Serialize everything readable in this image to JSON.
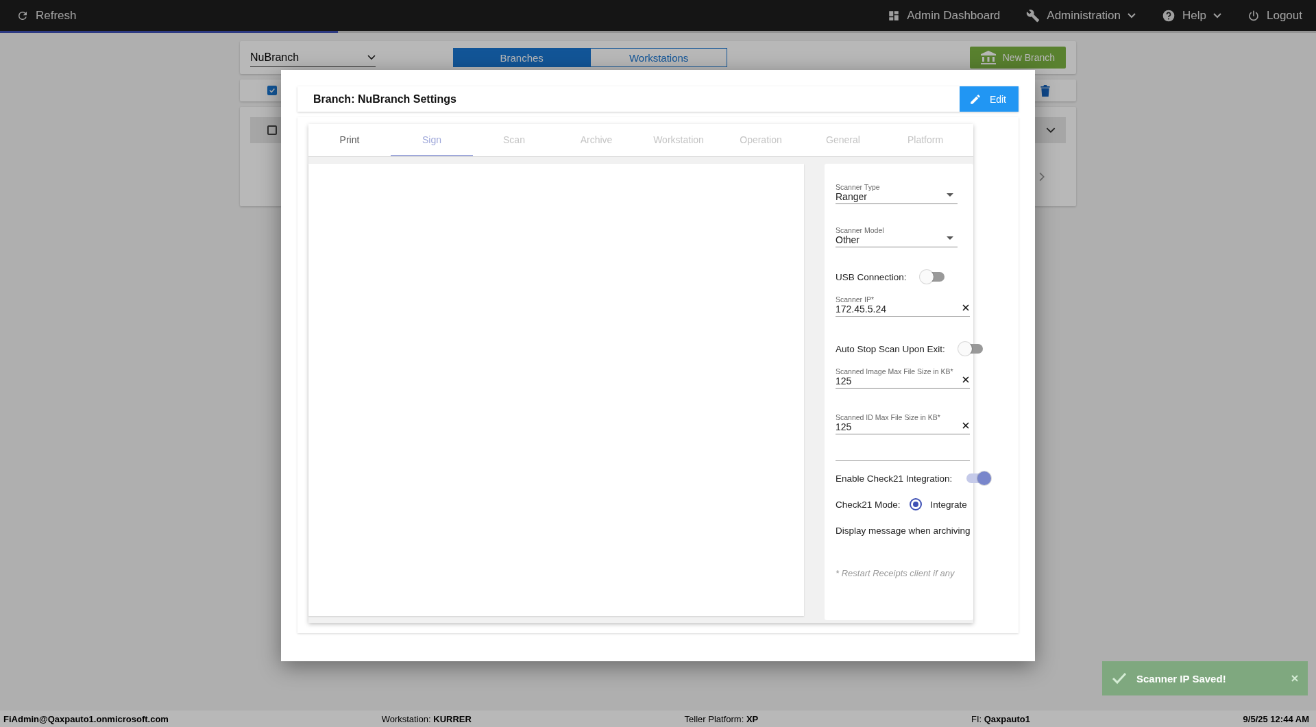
{
  "top_bar": {
    "refresh": "Refresh",
    "nav": [
      {
        "kind": "dashboard",
        "label": "Admin Dashboard",
        "dropdown": false
      },
      {
        "kind": "wrench",
        "label": "Administration",
        "dropdown": true
      },
      {
        "kind": "help",
        "label": "Help",
        "dropdown": true
      },
      {
        "kind": "power",
        "label": "Logout",
        "dropdown": false
      }
    ]
  },
  "progress": {
    "level": 0.257
  },
  "page": {
    "branch_select": "NuBranch",
    "toggle": [
      {
        "label": "Branches",
        "selected": true
      },
      {
        "label": "Workstations",
        "selected": false
      }
    ],
    "new_button": "New Branch",
    "select_all_checked": true,
    "row_checked": false
  },
  "dialog": {
    "title": "Branch: NuBranch Settings",
    "edit_button": "Edit",
    "tabs": [
      {
        "label": "Print",
        "selected": false,
        "disabled": false
      },
      {
        "label": "Sign",
        "selected": true,
        "disabled": false
      },
      {
        "label": "Scan",
        "selected": false,
        "disabled": true
      },
      {
        "label": "Archive",
        "selected": false,
        "disabled": true
      },
      {
        "label": "Workstation",
        "selected": false,
        "disabled": true
      },
      {
        "label": "Operation",
        "selected": false,
        "disabled": true
      },
      {
        "label": "General",
        "selected": false,
        "disabled": true
      },
      {
        "label": "Platform",
        "selected": false,
        "disabled": true
      }
    ],
    "fields": [
      {
        "kind": "select",
        "label": "Scanner Type",
        "value": "Ranger"
      },
      {
        "kind": "select",
        "label": "Scanner Model",
        "value": "Other"
      },
      {
        "kind": "toggle",
        "label": "USB Connection:",
        "on": false
      },
      {
        "kind": "text",
        "label": "Scanner IP*",
        "value": "172.45.5.24"
      },
      {
        "kind": "toggle",
        "label": "Auto Stop Scan Upon Exit:",
        "on": false
      },
      {
        "kind": "text",
        "label": "Scanned Image Max File Size in KB*",
        "value": "125"
      },
      {
        "kind": "text",
        "label": "Scanned ID Max File Size in KB*",
        "value": "125"
      },
      {
        "kind": "rule"
      },
      {
        "kind": "toggle",
        "label": "Enable Check21 Integration:",
        "on": true
      },
      {
        "kind": "radio",
        "label": "Check21 Mode:",
        "options": [
          {
            "label": "Integrate",
            "selected": true
          }
        ]
      },
      {
        "kind": "note",
        "label": "Display message when archiving"
      }
    ],
    "footnote": "* Restart Receipts client if any"
  },
  "toast": {
    "message": "Scanner IP Saved!"
  },
  "status_bar": {
    "user": "FiAdmin@Qaxpauto1.onmicrosoft.com",
    "items": [
      "Workstation: **KURRER**",
      "Teller Platform: **XP**",
      "FI: **Qaxpauto1**"
    ],
    "datetime": "9/5/25 12:44 AM"
  }
}
